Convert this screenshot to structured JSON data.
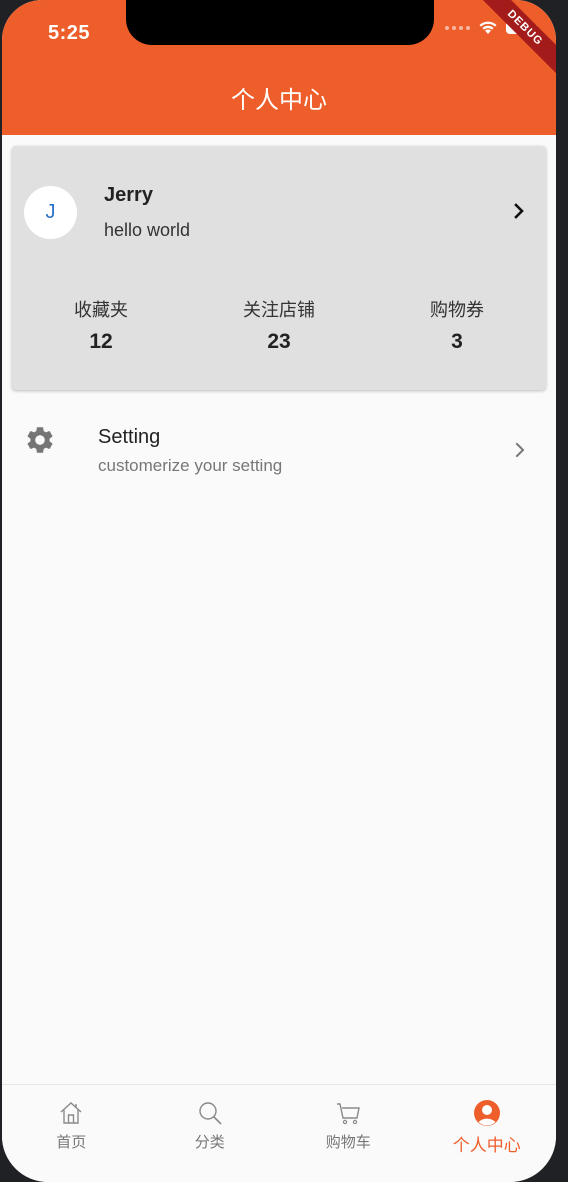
{
  "status_bar": {
    "time": "5:25",
    "debug_label": "DEBUG"
  },
  "app_bar": {
    "title": "个人中心"
  },
  "profile": {
    "avatar_initial": "J",
    "name": "Jerry",
    "bio": "hello world",
    "stats": [
      {
        "label": "收藏夹",
        "value": "12"
      },
      {
        "label": "关注店铺",
        "value": "23"
      },
      {
        "label": "购物券",
        "value": "3"
      }
    ]
  },
  "settings_item": {
    "title": "Setting",
    "subtitle": "customerize your setting",
    "icon": "gear-icon"
  },
  "bottom_nav": {
    "items": [
      {
        "label": "首页",
        "icon": "home-icon"
      },
      {
        "label": "分类",
        "icon": "search-icon"
      },
      {
        "label": "购物车",
        "icon": "cart-icon"
      },
      {
        "label": "个人中心",
        "icon": "person-icon"
      }
    ],
    "active_index": 3
  },
  "colors": {
    "primary": "#ee5e2b",
    "card": "#e0e0e0",
    "background": "#fafafa"
  }
}
